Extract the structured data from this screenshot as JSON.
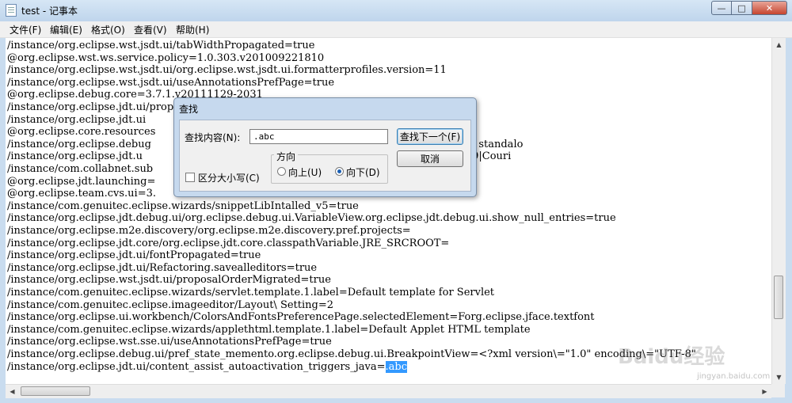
{
  "window": {
    "title": "test - 记事本",
    "buttons": {
      "minimize": "—",
      "maximize": "□",
      "close": "✕"
    }
  },
  "menu": [
    {
      "label": "文件(F)"
    },
    {
      "label": "编辑(E)"
    },
    {
      "label": "格式(O)"
    },
    {
      "label": "查看(V)"
    },
    {
      "label": "帮助(H)"
    }
  ],
  "editor": {
    "lines": [
      "/instance/org.eclipse.wst.jsdt.ui/tabWidthPropagated=true",
      "@org.eclipse.wst.ws.service.policy=1.0.303.v201009221810",
      "/instance/org.eclipse.wst.jsdt.ui/org.eclipse.wst.jsdt.ui.formatterprofiles.version=11",
      "/instance/org.eclipse.wst.jsdt.ui/useAnnotationsPrefPage=true",
      "@org.eclipse.debug.core=3.7.1.v20111129-2031",
      "/instance/org.eclipse.jdt.ui/proposalOrderMigrated=true",
      "/instance/org.eclipse.jdt.ui",
      "@org.eclipse.core.resources",
      "/instance/org.eclipse.debug                              =<?xml version\\=\"1.0\" encoding\\=\"UTF-8\" standalo",
      "/instance/org.eclipse.jdt.u                              0|WINDOWS|1|-19|0|0|0|400|0|0|0|0|3|2|1|49|Couri",
      "/instance/com.collabnet.sub",
      "@org.eclipse.jdt.launching=",
      "@org.eclipse.team.cvs.ui=3.",
      "/instance/com.genuitec.eclipse.wizards/snippetLibIntalled_v5=true",
      "/instance/org.eclipse.jdt.debug.ui/org.eclipse.debug.ui.VariableView.org.eclipse.jdt.debug.ui.show_null_entries=true",
      "/instance/org.eclipse.m2e.discovery/org.eclipse.m2e.discovery.pref.projects=",
      "/instance/org.eclipse.jdt.core/org.eclipse.jdt.core.classpathVariable.JRE_SRCROOT=",
      "/instance/org.eclipse.jdt.ui/fontPropagated=true",
      "/instance/org.eclipse.jdt.ui/Refactoring.savealleditors=true",
      "/instance/org.eclipse.wst.jsdt.ui/proposalOrderMigrated=true",
      "/instance/com.genuitec.eclipse.wizards/servlet.template.1.label=Default template for Servlet",
      "/instance/com.genuitec.eclipse.imageeditor/Layout\\ Setting=2",
      "/instance/org.eclipse.ui.workbench/ColorsAndFontsPreferencePage.selectedElement=Forg.eclipse.jface.textfont",
      "/instance/com.genuitec.eclipse.wizards/applethtml.template.1.label=Default Applet HTML template",
      "/instance/org.eclipse.wst.sse.ui/useAnnotationsPrefPage=true",
      "/instance/org.eclipse.debug.ui/pref_state_memento.org.eclipse.debug.ui.BreakpointView=<?xml version\\=\"1.0\" encoding\\=\"UTF-8\""
    ],
    "last_line_prefix": "/instance/org.eclipse.jdt.ui/content_assist_autoactivation_triggers_java=",
    "last_line_selected": ".abc"
  },
  "find_dialog": {
    "title": "查找",
    "find_label": "查找内容(N):",
    "find_value": ".abc",
    "find_next_button": "查找下一个(F)",
    "cancel_button": "取消",
    "direction_label": "方向",
    "up_label": "向上(U)",
    "down_label": "向下(D)",
    "direction_selected": "down",
    "match_case_label": "区分大小写(C)",
    "match_case_checked": false
  },
  "watermark": {
    "brand": "Baidu经验",
    "url": "jingyan.baidu.com"
  }
}
